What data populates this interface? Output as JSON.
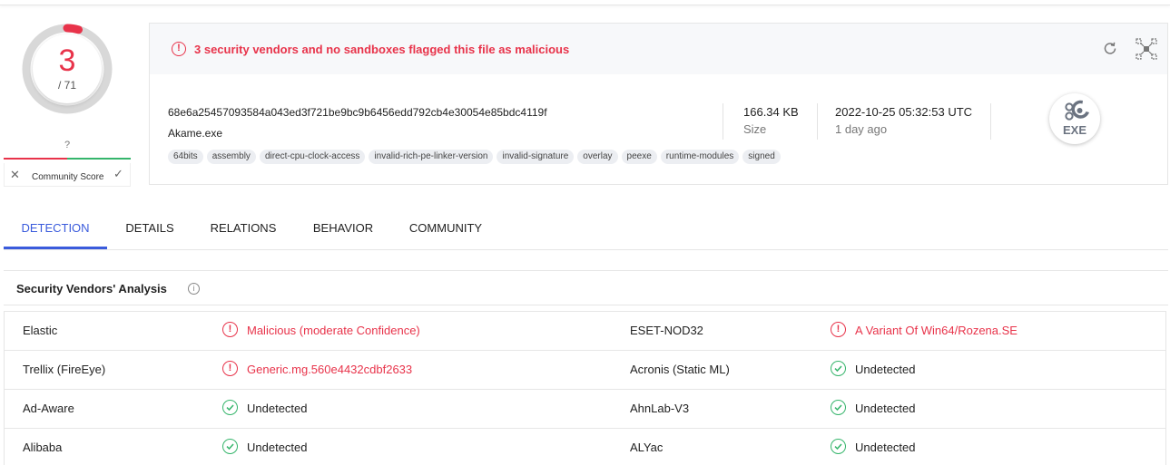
{
  "score": {
    "detections": "3",
    "total": "/ 71",
    "max": 71,
    "detected": 3
  },
  "community": {
    "unknown": "?",
    "label": "Community Score",
    "down": "✕",
    "up": "✓"
  },
  "alert": {
    "text": "3 security vendors and no sandboxes flagged this file as malicious"
  },
  "file": {
    "hash": "68e6a25457093584a043ed3f721be9bc9b6456edd792cb4e30054e85bdc4119f",
    "name": "Akame.exe",
    "size": "166.34 KB",
    "size_label": "Size",
    "date": "2022-10-25 05:32:53 UTC",
    "date_relative": "1 day ago",
    "type_badge": "EXE"
  },
  "tags": [
    "64bits",
    "assembly",
    "direct-cpu-clock-access",
    "invalid-rich-pe-linker-version",
    "invalid-signature",
    "overlay",
    "peexe",
    "runtime-modules",
    "signed"
  ],
  "tabs": [
    {
      "label": "DETECTION",
      "active": true
    },
    {
      "label": "DETAILS",
      "active": false
    },
    {
      "label": "RELATIONS",
      "active": false
    },
    {
      "label": "BEHAVIOR",
      "active": false
    },
    {
      "label": "COMMUNITY",
      "active": false
    }
  ],
  "section": {
    "title": "Security Vendors' Analysis"
  },
  "vendors": [
    {
      "left": {
        "name": "Elastic",
        "result": "Malicious (moderate Confidence)",
        "status": "malicious"
      },
      "right": {
        "name": "ESET-NOD32",
        "result": "A Variant Of Win64/Rozena.SE",
        "status": "malicious"
      }
    },
    {
      "left": {
        "name": "Trellix (FireEye)",
        "result": "Generic.mg.560e4432cdbf2633",
        "status": "malicious"
      },
      "right": {
        "name": "Acronis (Static ML)",
        "result": "Undetected",
        "status": "undetected"
      }
    },
    {
      "left": {
        "name": "Ad-Aware",
        "result": "Undetected",
        "status": "undetected"
      },
      "right": {
        "name": "AhnLab-V3",
        "result": "Undetected",
        "status": "undetected"
      }
    },
    {
      "left": {
        "name": "Alibaba",
        "result": "Undetected",
        "status": "undetected"
      },
      "right": {
        "name": "ALYac",
        "result": "Undetected",
        "status": "undetected"
      }
    }
  ],
  "colors": {
    "malicious": "#e8334a",
    "clean": "#35b56b",
    "accent": "#3a5bdc",
    "gauge_track": "#d6d6d6"
  }
}
